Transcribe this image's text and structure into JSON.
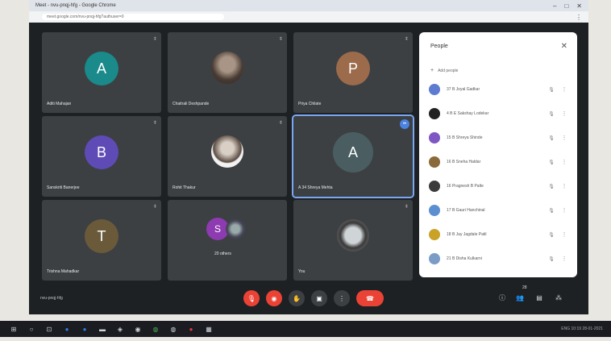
{
  "browser": {
    "tab_title": "Meet - nvu-pnqj-hfg - Google Chrome",
    "url": "meet.google.com/nvu-pnqj-hfg?authuser=0",
    "window_controls": [
      "–",
      "□",
      "✕"
    ],
    "menu_icon": "⋮"
  },
  "tiles": [
    {
      "name": "Aditi Mahajan",
      "initial": "A",
      "color": "#1a8a8a",
      "kind": "initial"
    },
    {
      "name": "Chaitrali Deshpande",
      "initial": "",
      "color": "",
      "kind": "photo"
    },
    {
      "name": "Priya Chilate",
      "initial": "P",
      "color": "#9c6b4b",
      "kind": "initial"
    },
    {
      "name": "Sanskriti Banerjee",
      "initial": "B",
      "color": "#5f4bb6",
      "kind": "initial"
    },
    {
      "name": "Rohit Thakur",
      "initial": "",
      "color": "",
      "kind": "photo"
    },
    {
      "name": "A 34 Shreya Mehta",
      "initial": "A",
      "color": "#4a5e62",
      "kind": "initial",
      "selected": true
    },
    {
      "name": "Trishna Mahadkar",
      "initial": "T",
      "color": "#6a5a3a",
      "kind": "initial"
    },
    {
      "name": "20 others",
      "initial": "S",
      "color": "#8e3ab0",
      "kind": "group"
    },
    {
      "name": "You",
      "initial": "",
      "color": "",
      "kind": "self"
    }
  ],
  "selected_badge": "••",
  "panel": {
    "title": "People",
    "close_icon": "✕",
    "add_people": "Add people",
    "people": [
      {
        "name": "37 B Joyal Gadkar",
        "color": "#5d7bd1"
      },
      {
        "name": "4 B E Sakshay Lodekar",
        "color": "#222"
      },
      {
        "name": "15 B Shreya Shinde",
        "color": "#7e57c2"
      },
      {
        "name": "16 B Sneha Haldar",
        "color": "#8a6a3a"
      },
      {
        "name": "16 Pragnesh B Palte",
        "color": "#3b3b3b"
      },
      {
        "name": "17 B Gauri Hanchinal",
        "color": "#5b8fd0"
      },
      {
        "name": "18 B Jay Jagdale Patil",
        "color": "#c9a227"
      },
      {
        "name": "21 B Disha Kulkarni",
        "color": "#7a9cc7"
      }
    ],
    "mic_icon": "🎙",
    "more_icon": "⋮"
  },
  "bottom_bar": {
    "meeting_code": "nvu-pnqj-hfg",
    "controls": {
      "mic": "🎙",
      "cam": "◉",
      "hand": "✋",
      "present": "▣",
      "more": "⋮",
      "end": "☎"
    },
    "right_controls": {
      "info": "ⓘ",
      "people": "👥",
      "chat": "▤",
      "activities": "⁂"
    },
    "people_count": "28"
  },
  "taskbar": {
    "icons": [
      "⊞",
      "○",
      "⊡",
      "●",
      "●",
      "▬",
      "◈",
      "◉",
      "◍",
      "◍",
      "●",
      "▦"
    ],
    "tray": "ENG 10:19 28-01-2021"
  }
}
